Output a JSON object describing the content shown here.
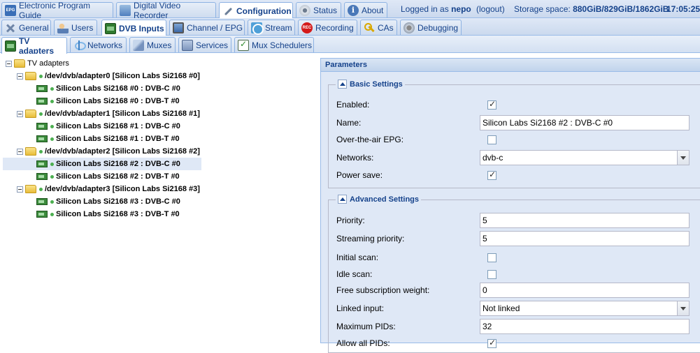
{
  "top_tabs": [
    {
      "label": "Electronic Program Guide",
      "icon": "epg-icon"
    },
    {
      "label": "Digital Video Recorder",
      "icon": "dvr-icon"
    },
    {
      "label": "Configuration",
      "icon": "wrench-icon"
    },
    {
      "label": "Status",
      "icon": "eye-icon"
    },
    {
      "label": "About",
      "icon": "info-icon"
    }
  ],
  "status": {
    "logged_in_prefix": "Logged in as",
    "user": "nepo",
    "logout": "(logout)",
    "storage_label": "Storage space:",
    "storage_value": "880GiB/829GiB/1862GiB",
    "time": "17:05:25"
  },
  "config_tabs": [
    {
      "label": "General"
    },
    {
      "label": "Users"
    },
    {
      "label": "DVB Inputs"
    },
    {
      "label": "Channel / EPG"
    },
    {
      "label": "Stream"
    },
    {
      "label": "Recording"
    },
    {
      "label": "CAs"
    },
    {
      "label": "Debugging"
    }
  ],
  "dvb_tabs": [
    {
      "label": "TV adapters"
    },
    {
      "label": "Networks"
    },
    {
      "label": "Muxes"
    },
    {
      "label": "Services"
    },
    {
      "label": "Mux Schedulers"
    }
  ],
  "tree": {
    "root": "TV adapters",
    "adapters": [
      {
        "label": "/dev/dvb/adapter0 [Silicon Labs Si2168 #0]",
        "frontends": [
          "Silicon Labs Si2168 #0 : DVB-C #0",
          "Silicon Labs Si2168 #0 : DVB-T #0"
        ]
      },
      {
        "label": "/dev/dvb/adapter1 [Silicon Labs Si2168 #1]",
        "frontends": [
          "Silicon Labs Si2168 #1 : DVB-C #0",
          "Silicon Labs Si2168 #1 : DVB-T #0"
        ]
      },
      {
        "label": "/dev/dvb/adapter2 [Silicon Labs Si2168 #2]",
        "frontends": [
          "Silicon Labs Si2168 #2 : DVB-C #0",
          "Silicon Labs Si2168 #2 : DVB-T #0"
        ]
      },
      {
        "label": "/dev/dvb/adapter3 [Silicon Labs Si2168 #3]",
        "frontends": [
          "Silicon Labs Si2168 #3 : DVB-C #0",
          "Silicon Labs Si2168 #3 : DVB-T #0"
        ]
      }
    ]
  },
  "parameters": {
    "title": "Parameters",
    "basic": {
      "legend": "Basic Settings",
      "enabled_label": "Enabled:",
      "enabled": true,
      "name_label": "Name:",
      "name_value": "Silicon Labs Si2168 #2 : DVB-C #0",
      "ota_label": "Over-the-air EPG:",
      "ota": false,
      "networks_label": "Networks:",
      "networks_value": "dvb-c",
      "power_label": "Power save:",
      "power": true
    },
    "advanced": {
      "legend": "Advanced Settings",
      "priority_label": "Priority:",
      "priority_value": "5",
      "streaming_label": "Streaming priority:",
      "streaming_value": "5",
      "initial_label": "Initial scan:",
      "initial": false,
      "idle_label": "Idle scan:",
      "idle": false,
      "weight_label": "Free subscription weight:",
      "weight_value": "0",
      "linked_label": "Linked input:",
      "linked_value": "Not linked",
      "maxpids_label": "Maximum PIDs:",
      "maxpids_value": "32",
      "allpids_label": "Allow all PIDs:",
      "allpids": true
    }
  }
}
